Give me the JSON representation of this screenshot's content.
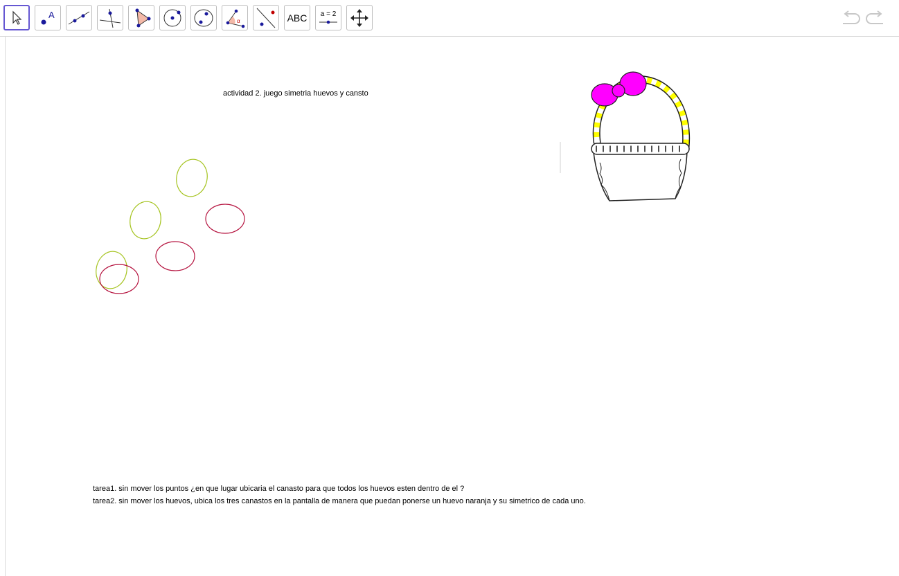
{
  "toolbar": {
    "tools": [
      {
        "icon": "move-arrow-icon",
        "active": true
      },
      {
        "icon": "point-icon",
        "label": "A"
      },
      {
        "icon": "line-icon"
      },
      {
        "icon": "perpendicular-line-icon"
      },
      {
        "icon": "polygon-icon"
      },
      {
        "icon": "circle-center-point-icon"
      },
      {
        "icon": "ellipse-icon"
      },
      {
        "icon": "angle-icon",
        "label": "α"
      },
      {
        "icon": "reflect-about-line-icon"
      },
      {
        "icon": "text-tool-icon",
        "label": "ABC"
      },
      {
        "icon": "slider-icon",
        "label": "a = 2"
      },
      {
        "icon": "move-graphics-view-icon"
      }
    ],
    "undo_icon": "undo-icon",
    "redo_icon": "redo-icon",
    "colors": {
      "active_border": "#6557d2",
      "point_blue": "#1a1a9c",
      "polygon_fill": "#f4b9a8",
      "ray_red": "#c00000"
    }
  },
  "canvas": {
    "title": "actividad 2. juego simetria huevos y cansto",
    "task1": "tarea1. sin mover los puntos ¿en que lugar ubicaria el canasto para que todos los huevos esten dentro de el ?",
    "task2": "tarea2. sin mover los huevos, ubica los tres canastos en la pantalla de manera que puedan ponerse un huevo naranja y su simetrico de cada uno.",
    "egg_colors": {
      "green": "#a6c421",
      "red": "#b5133f"
    },
    "basket": {
      "bow_color": "#ff00ff",
      "handle_color": "#ffff00"
    }
  }
}
